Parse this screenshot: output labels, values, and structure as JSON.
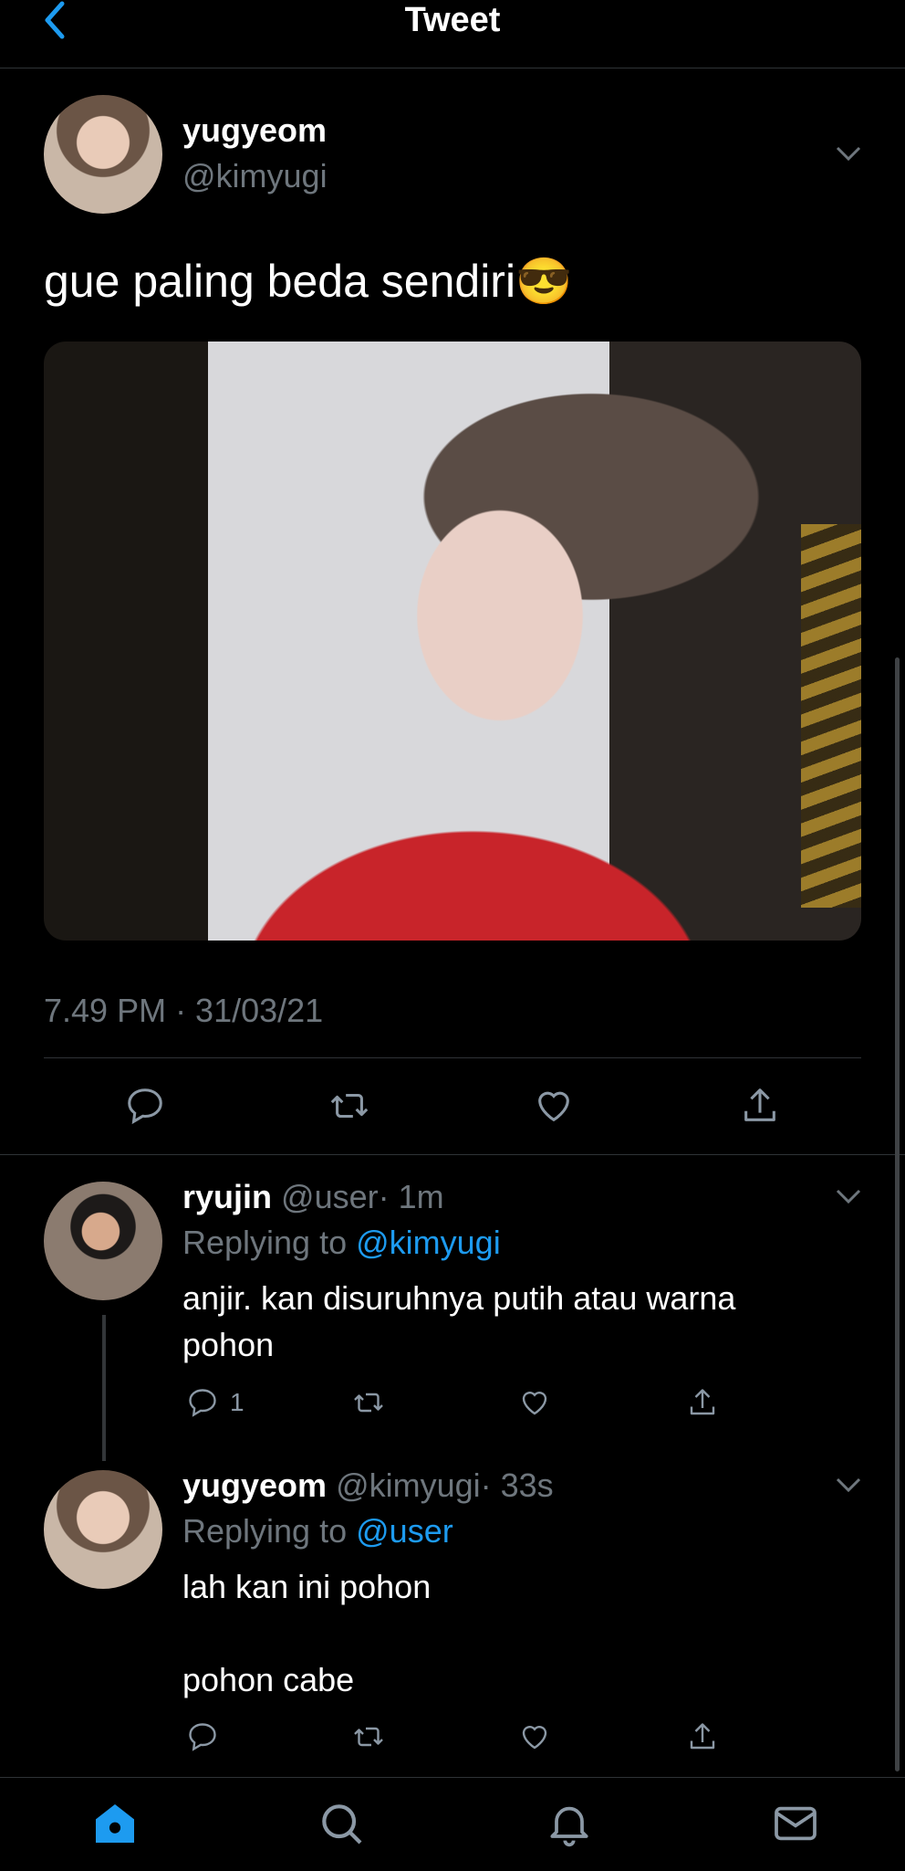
{
  "header": {
    "title": "Tweet",
    "back_icon": "chevron-left-icon"
  },
  "colors": {
    "accent": "#1d9bf0",
    "background": "#000000",
    "secondary_text": "#6e767d"
  },
  "main_tweet": {
    "display_name": "yugyeom",
    "handle": "@kimyugi",
    "text": "gue paling beda sendiri😎",
    "timestamp": "7.49 PM · 31/03/21"
  },
  "replies": [
    {
      "display_name": "ryujin",
      "handle": "@user",
      "time": "· 1m",
      "replying_prefix": "Replying to",
      "replying_to": "@kimyugi",
      "text_line1": "anjir. kan disuruhnya putih atau warna",
      "text_line2": "pohon",
      "reply_count": "1"
    },
    {
      "display_name": "yugyeom",
      "handle": "@kimyugi",
      "time": "· 33s",
      "replying_prefix": "Replying to",
      "replying_to": "@user",
      "text_line1": "lah kan ini pohon",
      "text_line2": "pohon cabe"
    }
  ],
  "icons": [
    "reply-icon",
    "retweet-icon",
    "like-icon",
    "share-icon",
    "home-icon",
    "search-icon",
    "notifications-icon",
    "messages-icon"
  ]
}
